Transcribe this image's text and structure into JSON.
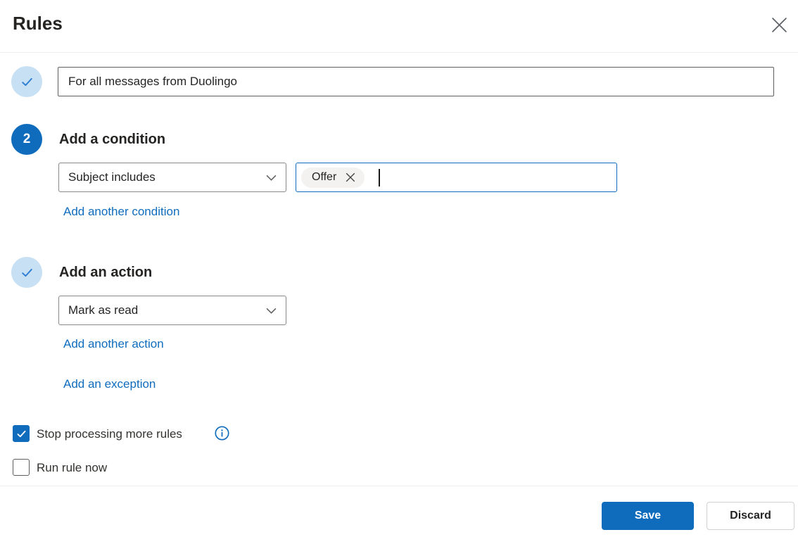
{
  "dialog": {
    "title": "Rules"
  },
  "rule_name": {
    "value": "For all messages from Duolingo"
  },
  "condition": {
    "step_number": "2",
    "heading": "Add a condition",
    "dropdown_value": "Subject includes",
    "tag_value": "Offer",
    "add_link": "Add another condition"
  },
  "action": {
    "heading": "Add an action",
    "dropdown_value": "Mark as read",
    "add_link": "Add another action",
    "exception_link": "Add an exception"
  },
  "options": {
    "stop_processing": {
      "label": "Stop processing more rules",
      "checked": true
    },
    "run_now": {
      "label": "Run rule now",
      "checked": false
    }
  },
  "footer": {
    "save_label": "Save",
    "discard_label": "Discard"
  },
  "icons": {
    "close": "close-icon",
    "chevron_down": "chevron-down-icon",
    "checkmark": "checkmark-icon",
    "dismiss_tag": "dismiss-icon",
    "info": "info-icon"
  },
  "colors": {
    "accent": "#0f6cbd",
    "accent_light": "#c7e0f4",
    "link": "#0f6cbd",
    "checkmark_light_circle": "#2b7cd3"
  }
}
